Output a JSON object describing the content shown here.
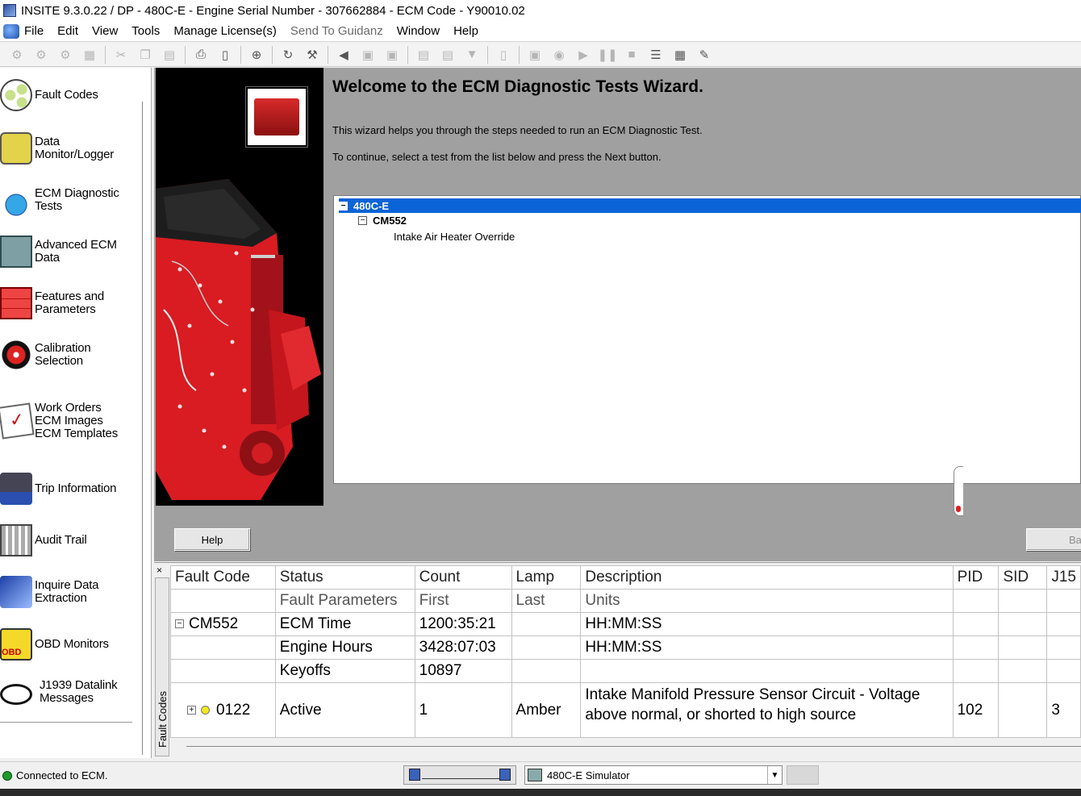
{
  "window": {
    "title": "INSITE 9.3.0.22  / DP - 480C-E  - Engine Serial Number - 307662884 - ECM Code - Y90010.02"
  },
  "menu": {
    "items": [
      "File",
      "Edit",
      "View",
      "Tools",
      "Manage License(s)",
      "Send To Guidanz",
      "Window",
      "Help"
    ]
  },
  "toolbar": {
    "icons": [
      "connect-icon",
      "disconnect-icon",
      "network-icon",
      "desk-icon",
      "cut-icon",
      "copy-icon",
      "paste-icon",
      "print-icon",
      "print-preview-icon",
      "binoculars-icon",
      "refresh-icon",
      "tools-icon",
      "horn-icon",
      "stack-icon",
      "camera-icon",
      "play-circle-icon",
      "play-icon",
      "pause-icon",
      "stop-icon",
      "checklist-icon",
      "report-icon",
      "notes-icon"
    ]
  },
  "nav": {
    "items": [
      {
        "lines": [
          "Fault Codes"
        ],
        "icon": "fault-codes-icon"
      },
      {
        "lines": [
          "Data",
          "Monitor/Logger"
        ],
        "icon": "data-monitor-icon"
      },
      {
        "lines": [
          "ECM Diagnostic",
          "Tests"
        ],
        "icon": "ecm-diagnostic-icon"
      },
      {
        "lines": [
          "Advanced ECM",
          "Data"
        ],
        "icon": "advanced-ecm-icon"
      },
      {
        "lines": [
          "Features and",
          "Parameters"
        ],
        "icon": "features-icon"
      },
      {
        "lines": [
          "Calibration",
          "Selection"
        ],
        "icon": "calibration-icon"
      },
      {
        "lines": [
          "Work Orders",
          "ECM Images",
          "ECM Templates"
        ],
        "icon": "work-orders-icon"
      },
      {
        "lines": [
          "Trip Information"
        ],
        "icon": "trip-icon"
      },
      {
        "lines": [
          "Audit  Trail"
        ],
        "icon": "audit-icon"
      },
      {
        "lines": [
          "Inquire Data",
          "Extraction"
        ],
        "icon": "inquire-icon"
      },
      {
        "lines": [
          "OBD Monitors"
        ],
        "icon": "obd-icon"
      },
      {
        "lines": [
          "J1939 Datalink",
          "Messages"
        ],
        "icon": "j1939-icon"
      }
    ]
  },
  "wizard": {
    "title": "Welcome to the ECM Diagnostic Tests Wizard.",
    "para1": "This wizard helps you through the steps needed to run an ECM Diagnostic Test.",
    "para2": "To continue, select a test from the list below and press the Next button.",
    "tree": {
      "root": "480C-E",
      "module": "CM552",
      "test": "Intake Air Heater Override",
      "expand_glyph": "−"
    },
    "buttons": {
      "help": "Help",
      "back": "Ba"
    }
  },
  "fault_panel": {
    "close": "×",
    "side_tab": "Fault Codes",
    "columns": [
      "Fault Code",
      "Status",
      "Count",
      "Lamp",
      "Description",
      "PID",
      "SID",
      "J15"
    ],
    "subheader": [
      "",
      "Fault Parameters",
      "First",
      "Last",
      "Units",
      "",
      "",
      ""
    ],
    "rows": [
      {
        "expander": "−",
        "code": "CM552",
        "status": "ECM Time",
        "count": "1200:35:21",
        "lamp": "",
        "description": "HH:MM:SS",
        "pid": "",
        "sid": "",
        "j15": ""
      },
      {
        "expander": "",
        "code": "",
        "status": "Engine Hours",
        "count": "3428:07:03",
        "lamp": "",
        "description": "HH:MM:SS",
        "pid": "",
        "sid": "",
        "j15": ""
      },
      {
        "expander": "",
        "code": "",
        "status": "Keyoffs",
        "count": "10897",
        "lamp": "",
        "description": "",
        "pid": "",
        "sid": "",
        "j15": ""
      },
      {
        "expander": "+",
        "code": "0122",
        "status": "Active",
        "count": "1",
        "lamp": "Amber",
        "description": "Intake Manifold Pressure Sensor Circuit - Voltage above normal, or shorted to high source",
        "pid": "102",
        "sid": "",
        "j15": "3"
      }
    ]
  },
  "status": {
    "text": "Connected to ECM.",
    "simulator": "480C-E Simulator",
    "colors": {
      "connected": "#1e9a2a",
      "selection": "#0a64d8"
    }
  }
}
